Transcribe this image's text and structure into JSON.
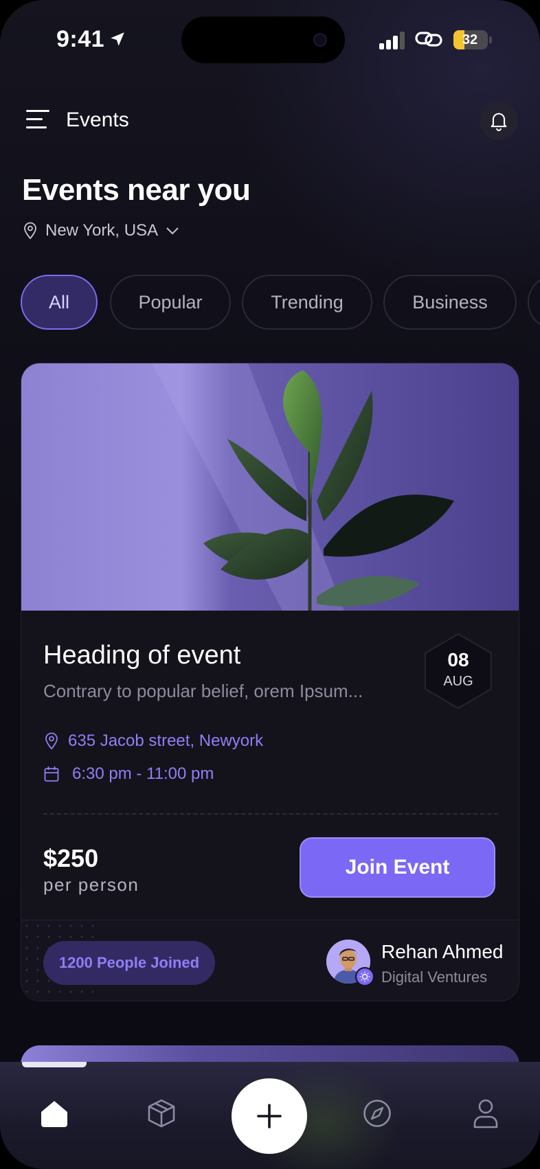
{
  "status_bar": {
    "time": "9:41",
    "battery": "32",
    "battery_level": 0.32
  },
  "header": {
    "title": "Events"
  },
  "hero": {
    "title": "Events near you",
    "location": "New York, USA"
  },
  "filters": [
    {
      "label": "All",
      "active": true
    },
    {
      "label": "Popular",
      "active": false
    },
    {
      "label": "Trending",
      "active": false
    },
    {
      "label": "Business",
      "active": false
    }
  ],
  "event": {
    "heading": "Heading of event",
    "description": "Contrary to popular belief, orem Ipsum...",
    "date_day": "08",
    "date_month": "AUG",
    "address": "635 Jacob street, Newyork",
    "time": "6:30 pm - 11:00 pm",
    "price": "$250",
    "price_unit": "per person",
    "join_label": "Join Event",
    "joined": "1200 People Joined",
    "host": {
      "name": "Rehan Ahmed",
      "company": "Digital Ventures"
    }
  },
  "tabbar": {
    "items": [
      "home-icon",
      "box-icon",
      "plus-icon",
      "compass-icon",
      "profile-icon"
    ],
    "active": "home-icon"
  },
  "colors": {
    "accent": "#7b68f5",
    "accent_text": "#8f7ff5",
    "background": "#0e0d16"
  }
}
